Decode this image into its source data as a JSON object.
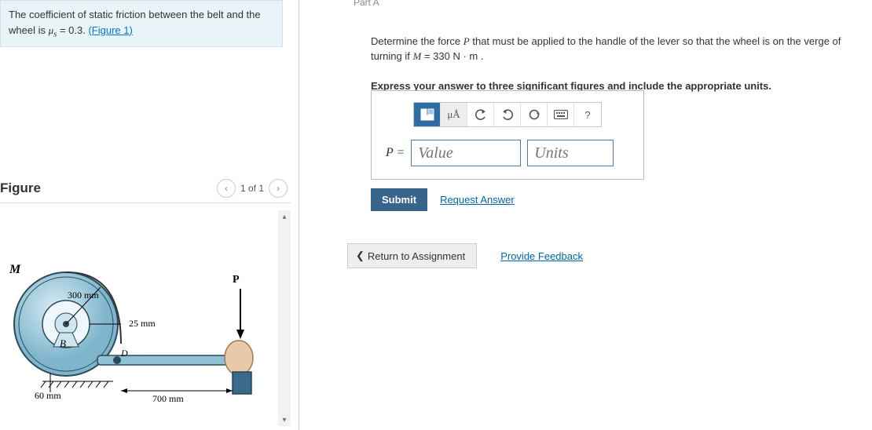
{
  "problem": {
    "text_a": "The coefficient of static friction between the belt and the wheel is ",
    "mu": "μ",
    "sub": "s",
    "eq": " = 0.3. ",
    "figlink": "(Figure 1)"
  },
  "figure": {
    "heading": "Figure",
    "pager": "1 of 1",
    "label_M": "M",
    "label_P": "P",
    "label_B": "B",
    "label_D": "D",
    "dim_300": "300 mm",
    "dim_25": "25 mm",
    "dim_60": "60 mm",
    "dim_700": "700 mm"
  },
  "part_crumb": "Part A",
  "question": {
    "line1a": "Determine the force ",
    "P": "P",
    "line1b": " that must be applied to the handle of the lever so that the wheel is on the verge of turning if ",
    "M": "M",
    "line1c": " = 330  N · m .",
    "line2": "Express your answer to three significant figures and include the appropriate units."
  },
  "toolbar": {
    "uA": "μÅ",
    "help": "?"
  },
  "answer": {
    "label": "P = ",
    "value_ph": "Value",
    "units_ph": "Units"
  },
  "actions": {
    "submit": "Submit",
    "request": "Request Answer",
    "return": "Return to Assignment",
    "feedback": "Provide Feedback"
  }
}
